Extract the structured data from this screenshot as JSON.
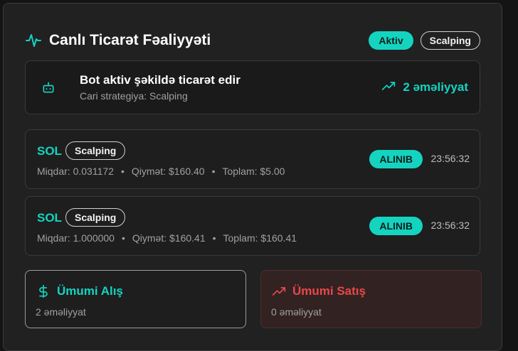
{
  "header": {
    "title": "Canlı Ticarət Fəaliyyəti",
    "badge_active": "Aktiv",
    "badge_strategy": "Scalping"
  },
  "status": {
    "main": "Bot aktiv şəkildə ticarət edir",
    "sub": "Cari strategiya: Scalping",
    "count": "2 əməliyyat"
  },
  "trades": [
    {
      "symbol": "SOL",
      "strategy": "Scalping",
      "amount": "Miqdar: 0.031172",
      "price": "Qiymət: $160.40",
      "total": "Toplam: $5.00",
      "status": "ALINIB",
      "time": "23:56:32"
    },
    {
      "symbol": "SOL",
      "strategy": "Scalping",
      "amount": "Miqdar: 1.000000",
      "price": "Qiymət: $160.41",
      "total": "Toplam: $160.41",
      "status": "ALINIB",
      "time": "23:56:32"
    }
  ],
  "summary": {
    "buy_label": "Ümumi Alış",
    "buy_count": "2 əməliyyat",
    "sell_label": "Ümumi Satış",
    "sell_count": "0 əməliyyat"
  },
  "icons": {
    "header": "activity-pulse-icon",
    "status": "bot-icon",
    "status_right": "trending-up-icon",
    "buy": "dollar-icon",
    "sell": "trending-up-icon"
  },
  "colors": {
    "accent": "#14d4c0",
    "danger": "#e84848",
    "background": "#212121"
  }
}
